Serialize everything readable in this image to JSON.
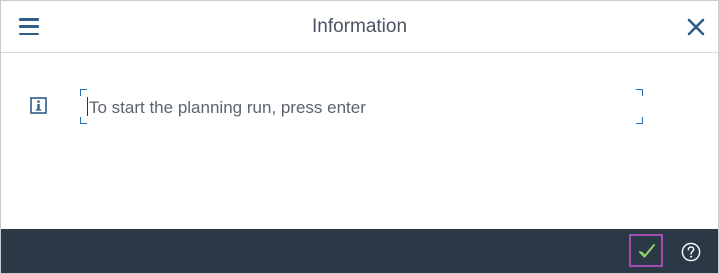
{
  "dialog": {
    "title": "Information",
    "message": "To start the planning run, press enter"
  },
  "icons": {
    "menu": "hamburger-menu-icon",
    "close": "close-icon",
    "info": "info-icon",
    "confirm": "checkmark-icon",
    "help": "help-icon"
  },
  "colors": {
    "accent": "#2f5d8c",
    "footer_bg": "#2b3947",
    "confirm_check": "#8fd16a",
    "focus_outline": "#a24fb5"
  }
}
